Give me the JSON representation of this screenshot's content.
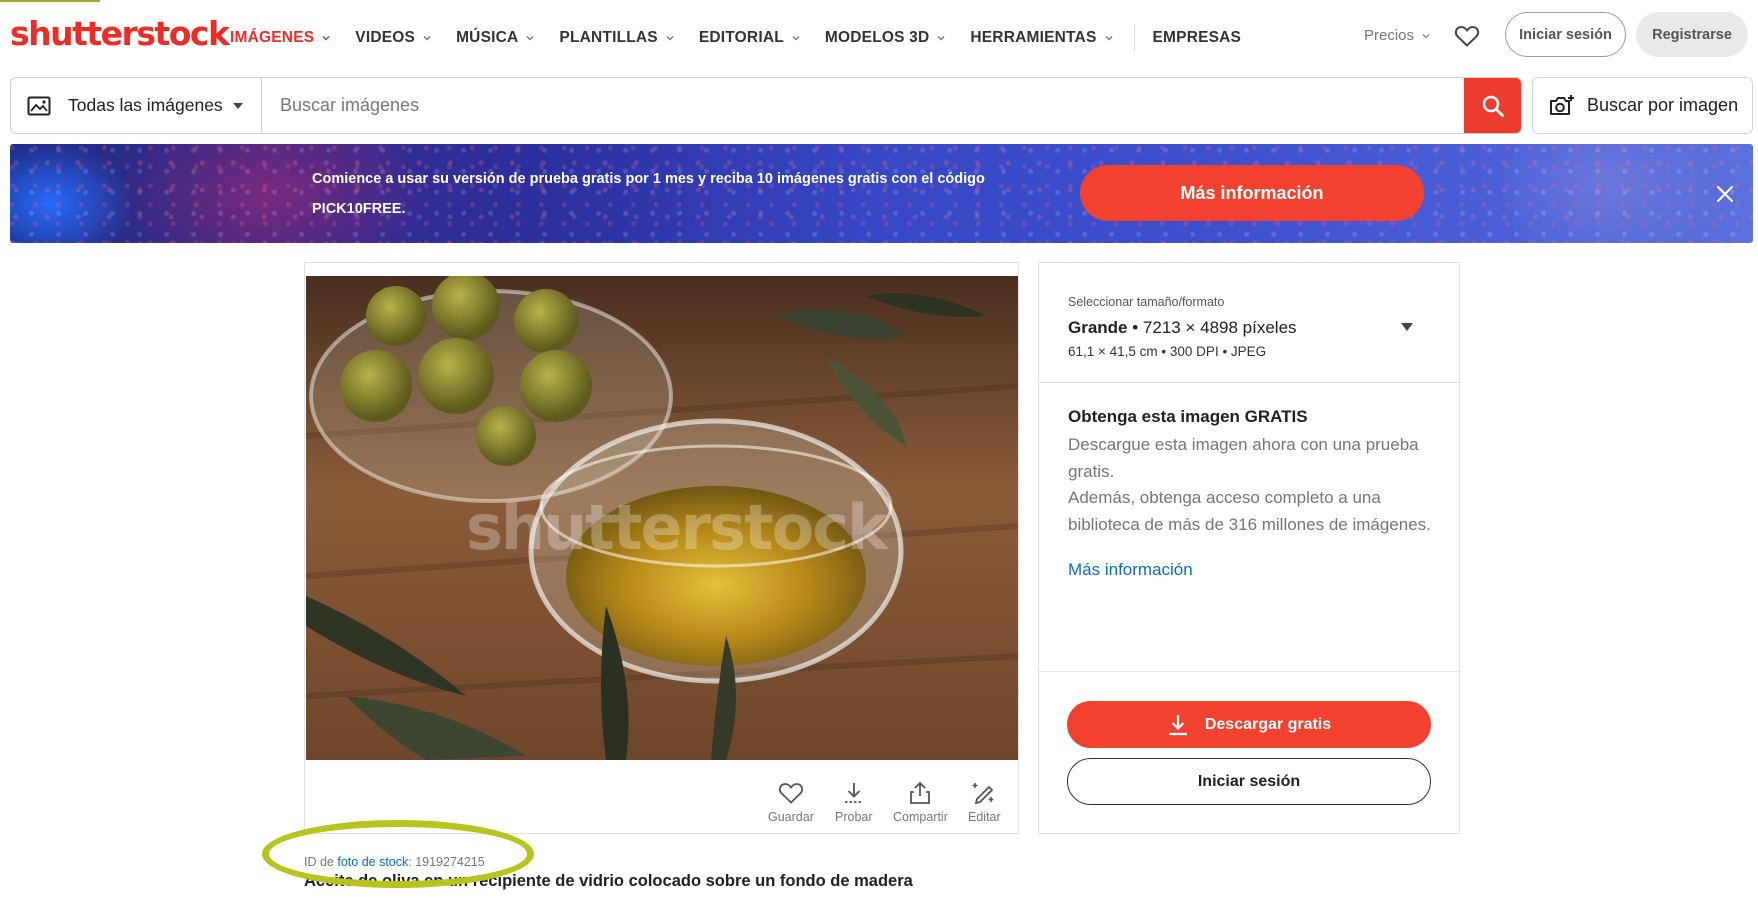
{
  "brand": {
    "logo_text": "shutterstock",
    "accent": "#ee2b24",
    "link": "#0c68c9"
  },
  "nav": {
    "items": [
      {
        "label": "IMÁGENES",
        "active": true,
        "dropdown": true
      },
      {
        "label": "VIDEOS",
        "active": false,
        "dropdown": true
      },
      {
        "label": "MÚSICA",
        "active": false,
        "dropdown": true
      },
      {
        "label": "PLANTILLAS",
        "active": false,
        "dropdown": true
      },
      {
        "label": "EDITORIAL",
        "active": false,
        "dropdown": true
      },
      {
        "label": "MODELOS 3D",
        "active": false,
        "dropdown": true
      },
      {
        "label": "HERRAMIENTAS",
        "active": false,
        "dropdown": true
      },
      {
        "label": "EMPRESAS",
        "active": false,
        "dropdown": false
      }
    ],
    "pricing_label": "Precios",
    "favorites_icon": "heart-icon",
    "login_label": "Iniciar sesión",
    "register_label": "Registrarse"
  },
  "search": {
    "type_label": "Todas las imágenes",
    "placeholder": "Buscar imágenes",
    "value": "",
    "search_icon": "search-icon",
    "search_by_image_label": "Buscar por imagen"
  },
  "promo": {
    "text_line1": "Comience a usar su versión de prueba gratis por 1 mes y reciba 10 imágenes gratis con el código",
    "text_line2": "PICK10FREE.",
    "cta_label": "Más información"
  },
  "image": {
    "watermark": "shutterstock",
    "actions": [
      {
        "label": "Guardar",
        "icon": "heart-icon"
      },
      {
        "label": "Probar",
        "icon": "download-icon"
      },
      {
        "label": "Compartir",
        "icon": "share-icon"
      },
      {
        "label": "Editar",
        "icon": "edit-icon"
      }
    ],
    "id_prefix": "ID de",
    "id_link": "foto de stock",
    "id_value": ": 1919274215",
    "title": "Aceite de oliva en un recipiente de vidrio colocado sobre un fondo de madera"
  },
  "panel": {
    "size_label": "Seleccionar tamaño/formato",
    "size_name": "Grande",
    "size_pixels": " • 7213 × 4898 píxeles",
    "size_meta": "61,1 × 41,5 cm • 300 DPI • JPEG",
    "free_title": "Obtenga esta imagen GRATIS",
    "free_body_1": "Descargue esta imagen ahora con una prueba gratis.",
    "free_body_2": "Además, obtenga acceso completo a una biblioteca de más de 316 millones de imágenes.",
    "free_link": "Más información",
    "download_label": "Descargar gratis",
    "login_label": "Iniciar sesión"
  }
}
